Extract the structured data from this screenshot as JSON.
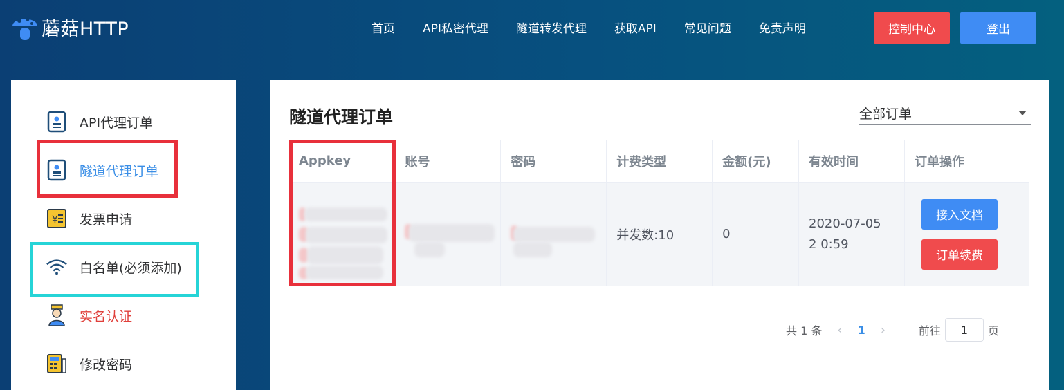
{
  "header": {
    "logo_text": "蘑菇HTTP",
    "nav": [
      "首页",
      "API私密代理",
      "隧道转发代理",
      "获取API",
      "常见问题",
      "免责声明"
    ],
    "console_label": "控制中心",
    "login_label": "登出"
  },
  "sidebar": {
    "items": [
      {
        "label": "API代理订单",
        "icon": "id-card-icon"
      },
      {
        "label": "隧道代理订单",
        "icon": "id-card-icon"
      },
      {
        "label": "发票申请",
        "icon": "invoice-icon"
      },
      {
        "label": "白名单(必须添加)",
        "icon": "wifi-icon"
      },
      {
        "label": "实名认证",
        "icon": "user-badge-icon"
      },
      {
        "label": "修改密码",
        "icon": "keypad-icon"
      }
    ]
  },
  "main": {
    "title": "隧道代理订单",
    "filter_value": "全部订单",
    "columns": [
      "Appkey",
      "账号",
      "密码",
      "计费类型",
      "金额(元)",
      "有效时间",
      "订单操作"
    ],
    "rows": [
      {
        "billing_type": "并发数:10",
        "amount": "0",
        "valid_time": "2020-07-05 2 0:59",
        "op_doc": "接入文档",
        "op_renew": "订单续费"
      }
    ],
    "pagination": {
      "total": "共 1 条",
      "prev": "‹",
      "current": "1",
      "next": "›",
      "goto_label": "前往",
      "goto_value": "1",
      "page_suffix": "页"
    }
  },
  "colors": {
    "accent_blue": "#3f8cf4",
    "accent_red": "#f04b4d",
    "highlight_red": "#e8303b",
    "highlight_cyan": "#26d4d7"
  }
}
